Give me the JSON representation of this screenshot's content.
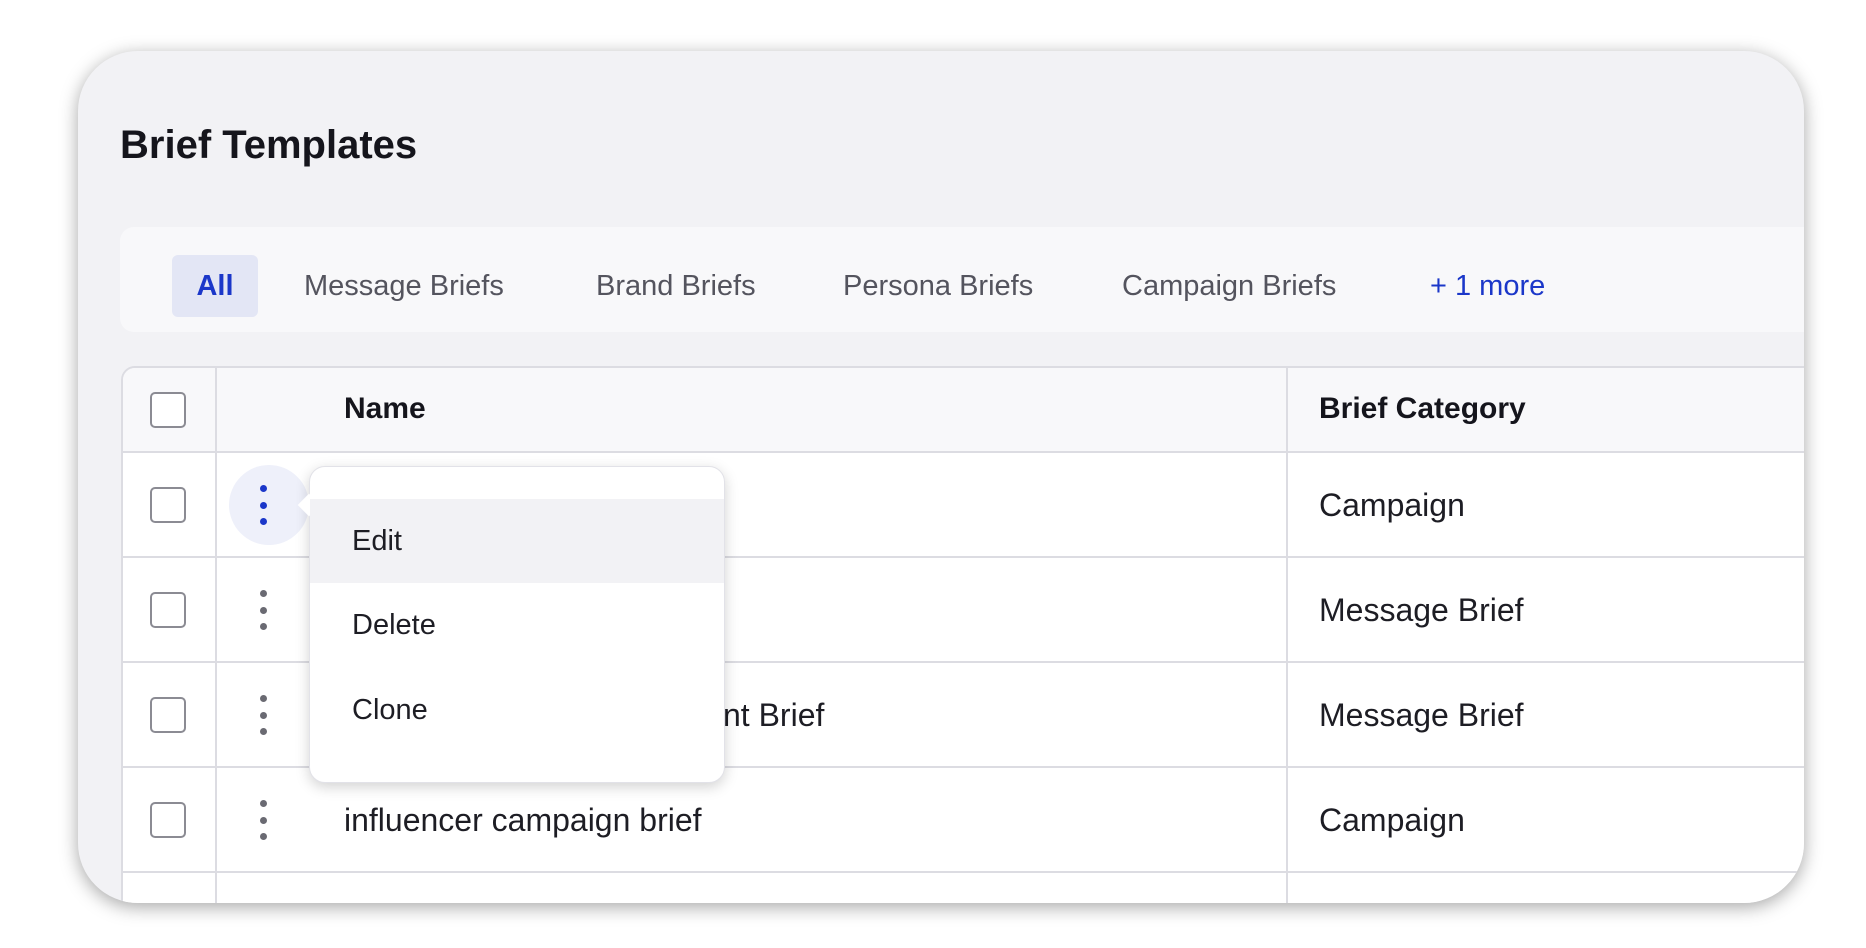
{
  "page": {
    "title": "Brief Templates"
  },
  "tabs": [
    {
      "label": "All",
      "active": true
    },
    {
      "label": "Message Briefs"
    },
    {
      "label": "Brand Briefs"
    },
    {
      "label": "Persona Briefs"
    },
    {
      "label": "Campaign Briefs"
    },
    {
      "label": "+ 1 more"
    }
  ],
  "table": {
    "columns": [
      "Name",
      "Brief Category"
    ],
    "rows": [
      {
        "name": "",
        "category": "Campaign"
      },
      {
        "name": "",
        "category": "Message Brief"
      },
      {
        "name": "nt Brief",
        "category": "Message Brief"
      },
      {
        "name": "influencer campaign brief",
        "category": "Campaign"
      }
    ]
  },
  "context_menu": {
    "items": [
      "Edit",
      "Delete",
      "Clone"
    ],
    "highlighted": "Edit"
  },
  "colors": {
    "accent": "#1b37c9",
    "background": "#f2f2f5"
  }
}
